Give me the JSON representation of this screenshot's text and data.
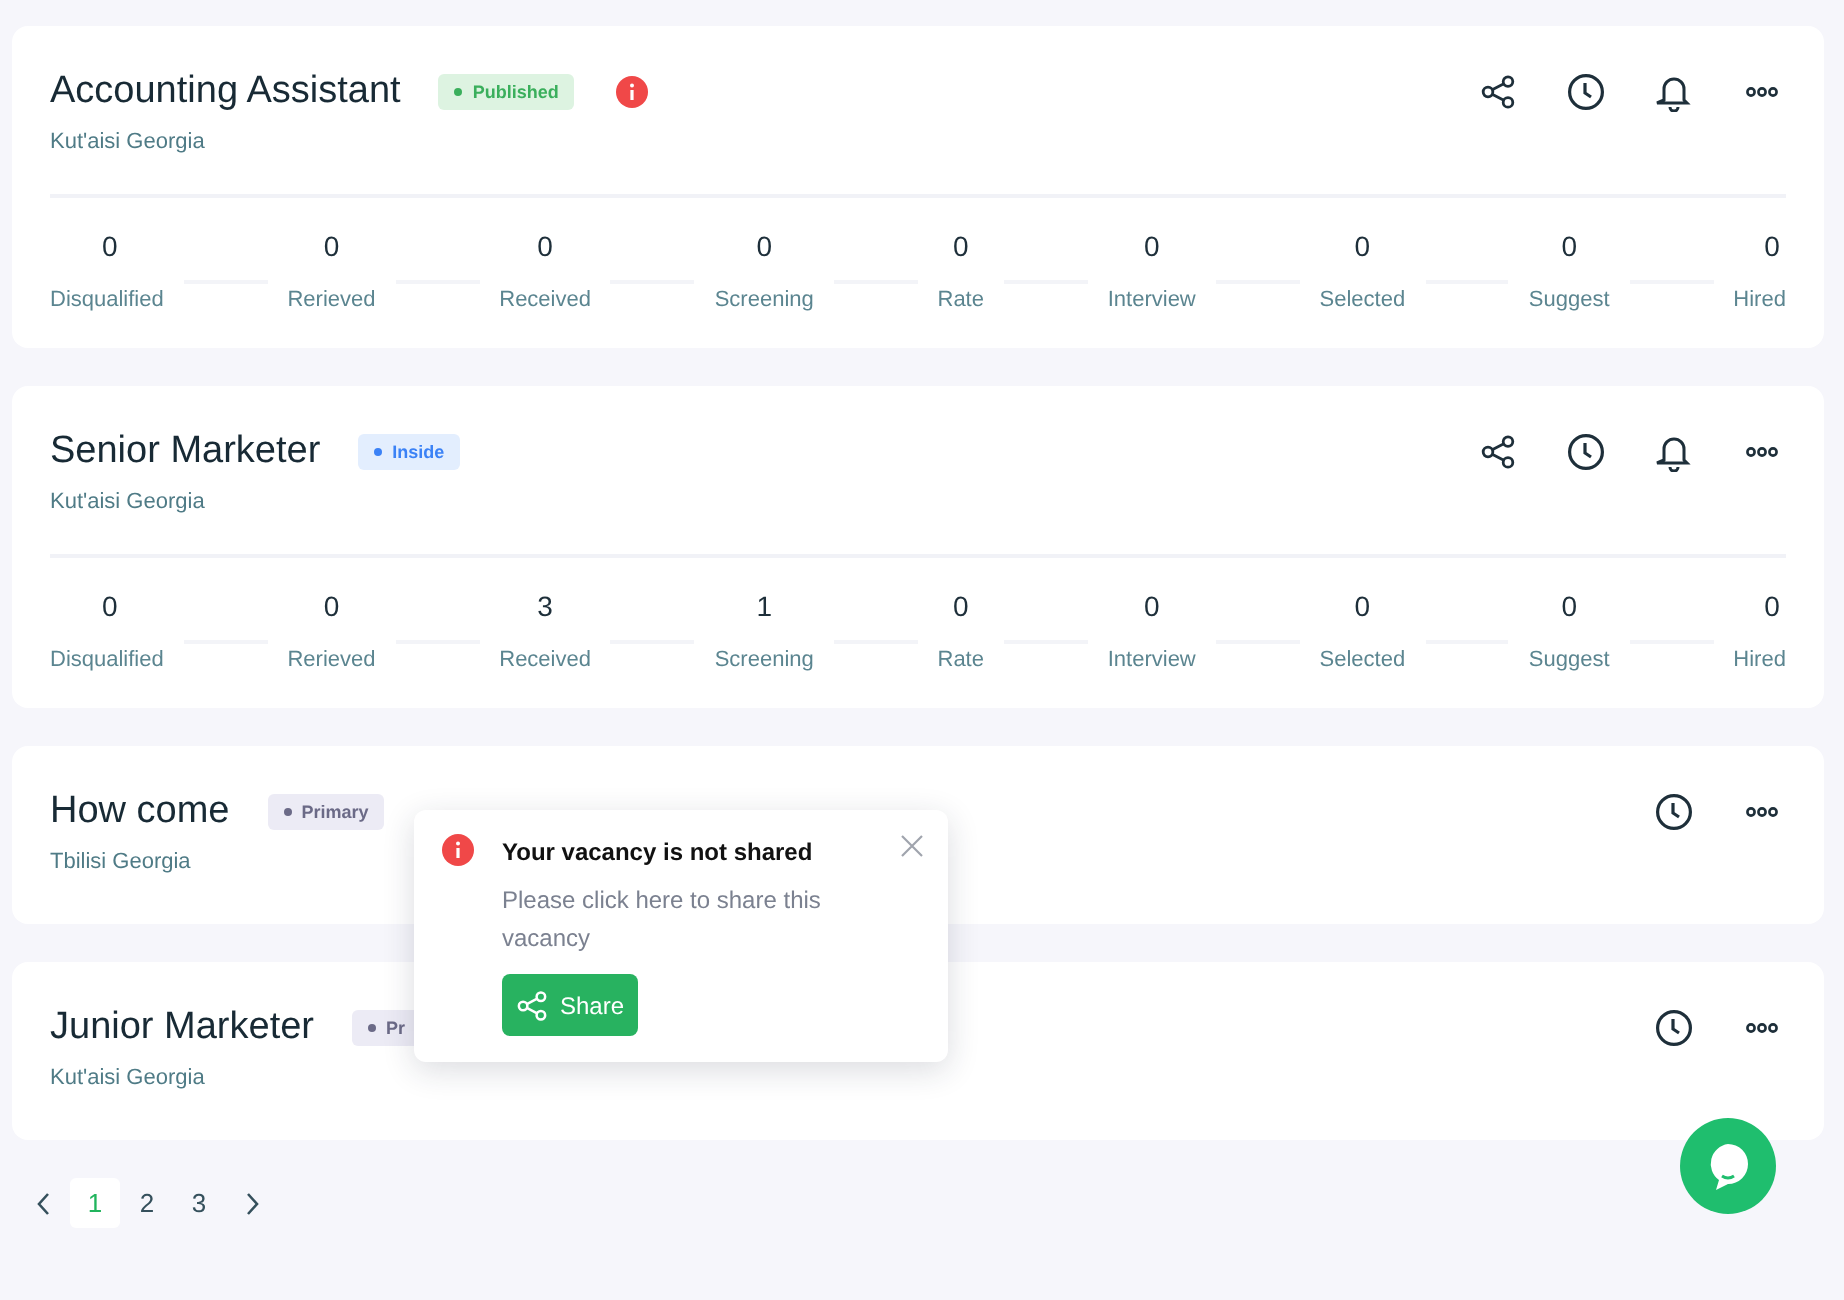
{
  "vacancies": [
    {
      "title": "Accounting Assistant",
      "status": {
        "label": "Published",
        "color": "#3aaf5c"
      },
      "alert": true,
      "location": "Kut'aisi Georgia",
      "actions": [
        {
          "kind": "share"
        },
        {
          "kind": "history"
        },
        {
          "kind": "bell"
        },
        {
          "kind": "more"
        }
      ],
      "stats": [
        {
          "value": "0",
          "label": "Disqualified"
        },
        {
          "value": "0",
          "label": "Rerieved"
        },
        {
          "value": "0",
          "label": "Received"
        },
        {
          "value": "0",
          "label": "Screening"
        },
        {
          "value": "0",
          "label": "Rate"
        },
        {
          "value": "0",
          "label": "Interview"
        },
        {
          "value": "0",
          "label": "Selected"
        },
        {
          "value": "0",
          "label": "Suggest"
        },
        {
          "value": "0",
          "label": "Hired"
        }
      ]
    },
    {
      "title": "Senior Marketer",
      "status": {
        "label": "Inside",
        "color": "#3b82f6"
      },
      "alert": false,
      "location": "Kut'aisi Georgia",
      "actions": [
        {
          "kind": "share"
        },
        {
          "kind": "history"
        },
        {
          "kind": "bell"
        },
        {
          "kind": "more"
        }
      ],
      "stats": [
        {
          "value": "0",
          "label": "Disqualified"
        },
        {
          "value": "0",
          "label": "Rerieved"
        },
        {
          "value": "3",
          "label": "Received"
        },
        {
          "value": "1",
          "label": "Screening"
        },
        {
          "value": "0",
          "label": "Rate"
        },
        {
          "value": "0",
          "label": "Interview"
        },
        {
          "value": "0",
          "label": "Selected"
        },
        {
          "value": "0",
          "label": "Suggest"
        },
        {
          "value": "0",
          "label": "Hired"
        }
      ]
    },
    {
      "title": "How come",
      "status": {
        "label": "Primary",
        "color": "#6b6a87"
      },
      "alert": false,
      "location": "Tbilisi Georgia",
      "actions": [
        {
          "kind": "history"
        },
        {
          "kind": "more"
        }
      ]
    },
    {
      "title": "Junior Marketer",
      "status": {
        "label": "Pr",
        "color": "#6b6a87"
      },
      "alert": false,
      "location": "Kut'aisi Georgia",
      "actions": [
        {
          "kind": "history"
        },
        {
          "kind": "more"
        }
      ]
    }
  ],
  "popup": {
    "title": "Your vacancy is not shared",
    "message": "Please click here to share this vacancy",
    "button": "Share"
  },
  "pagination": {
    "pages": [
      {
        "label": "1",
        "selected": true
      },
      {
        "label": "2",
        "selected": false
      },
      {
        "label": "3",
        "selected": false
      }
    ]
  }
}
